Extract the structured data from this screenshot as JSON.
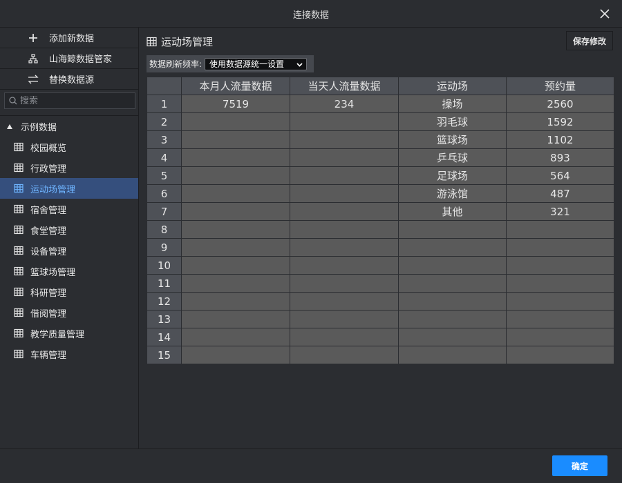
{
  "window": {
    "title": "连接数据"
  },
  "sidebar": {
    "actions": [
      {
        "label": "添加新数据",
        "icon": "plus-icon"
      },
      {
        "label": "山海鲸数据管家",
        "icon": "hierarchy-icon"
      },
      {
        "label": "替换数据源",
        "icon": "swap-icon"
      }
    ],
    "search": {
      "placeholder": "搜索"
    },
    "root": {
      "label": "示例数据",
      "icon": "cloud-icon"
    },
    "items": [
      {
        "label": "校园概览",
        "active": false
      },
      {
        "label": "行政管理",
        "active": false
      },
      {
        "label": "运动场管理",
        "active": true
      },
      {
        "label": "宿舍管理",
        "active": false
      },
      {
        "label": "食堂管理",
        "active": false
      },
      {
        "label": "设备管理",
        "active": false
      },
      {
        "label": "篮球场管理",
        "active": false
      },
      {
        "label": "科研管理",
        "active": false
      },
      {
        "label": "借阅管理",
        "active": false
      },
      {
        "label": "教学质量管理",
        "active": false
      },
      {
        "label": "车辆管理",
        "active": false
      }
    ]
  },
  "main": {
    "title": "运动场管理",
    "save_label": "保存修改",
    "refresh": {
      "label": "数据刷新频率:",
      "selected": "使用数据源统一设置"
    },
    "table": {
      "columns": [
        "本月人流量数据",
        "当天人流量数据",
        "运动场",
        "预约量"
      ],
      "rows": [
        [
          "1",
          "7519",
          "234",
          "操场",
          "2560"
        ],
        [
          "2",
          "",
          "",
          "羽毛球",
          "1592"
        ],
        [
          "3",
          "",
          "",
          "篮球场",
          "1102"
        ],
        [
          "4",
          "",
          "",
          "乒乓球",
          "893"
        ],
        [
          "5",
          "",
          "",
          "足球场",
          "564"
        ],
        [
          "6",
          "",
          "",
          "游泳馆",
          "487"
        ],
        [
          "7",
          "",
          "",
          "其他",
          "321"
        ],
        [
          "8",
          "",
          "",
          "",
          ""
        ],
        [
          "9",
          "",
          "",
          "",
          ""
        ],
        [
          "10",
          "",
          "",
          "",
          ""
        ],
        [
          "11",
          "",
          "",
          "",
          ""
        ],
        [
          "12",
          "",
          "",
          "",
          ""
        ],
        [
          "13",
          "",
          "",
          "",
          ""
        ],
        [
          "14",
          "",
          "",
          "",
          ""
        ],
        [
          "15",
          "",
          "",
          "",
          ""
        ]
      ]
    }
  },
  "footer": {
    "ok_label": "确定"
  },
  "colors": {
    "accent": "#1a8cff",
    "active_bg": "#354f7d",
    "active_text": "#6eb4ff"
  }
}
